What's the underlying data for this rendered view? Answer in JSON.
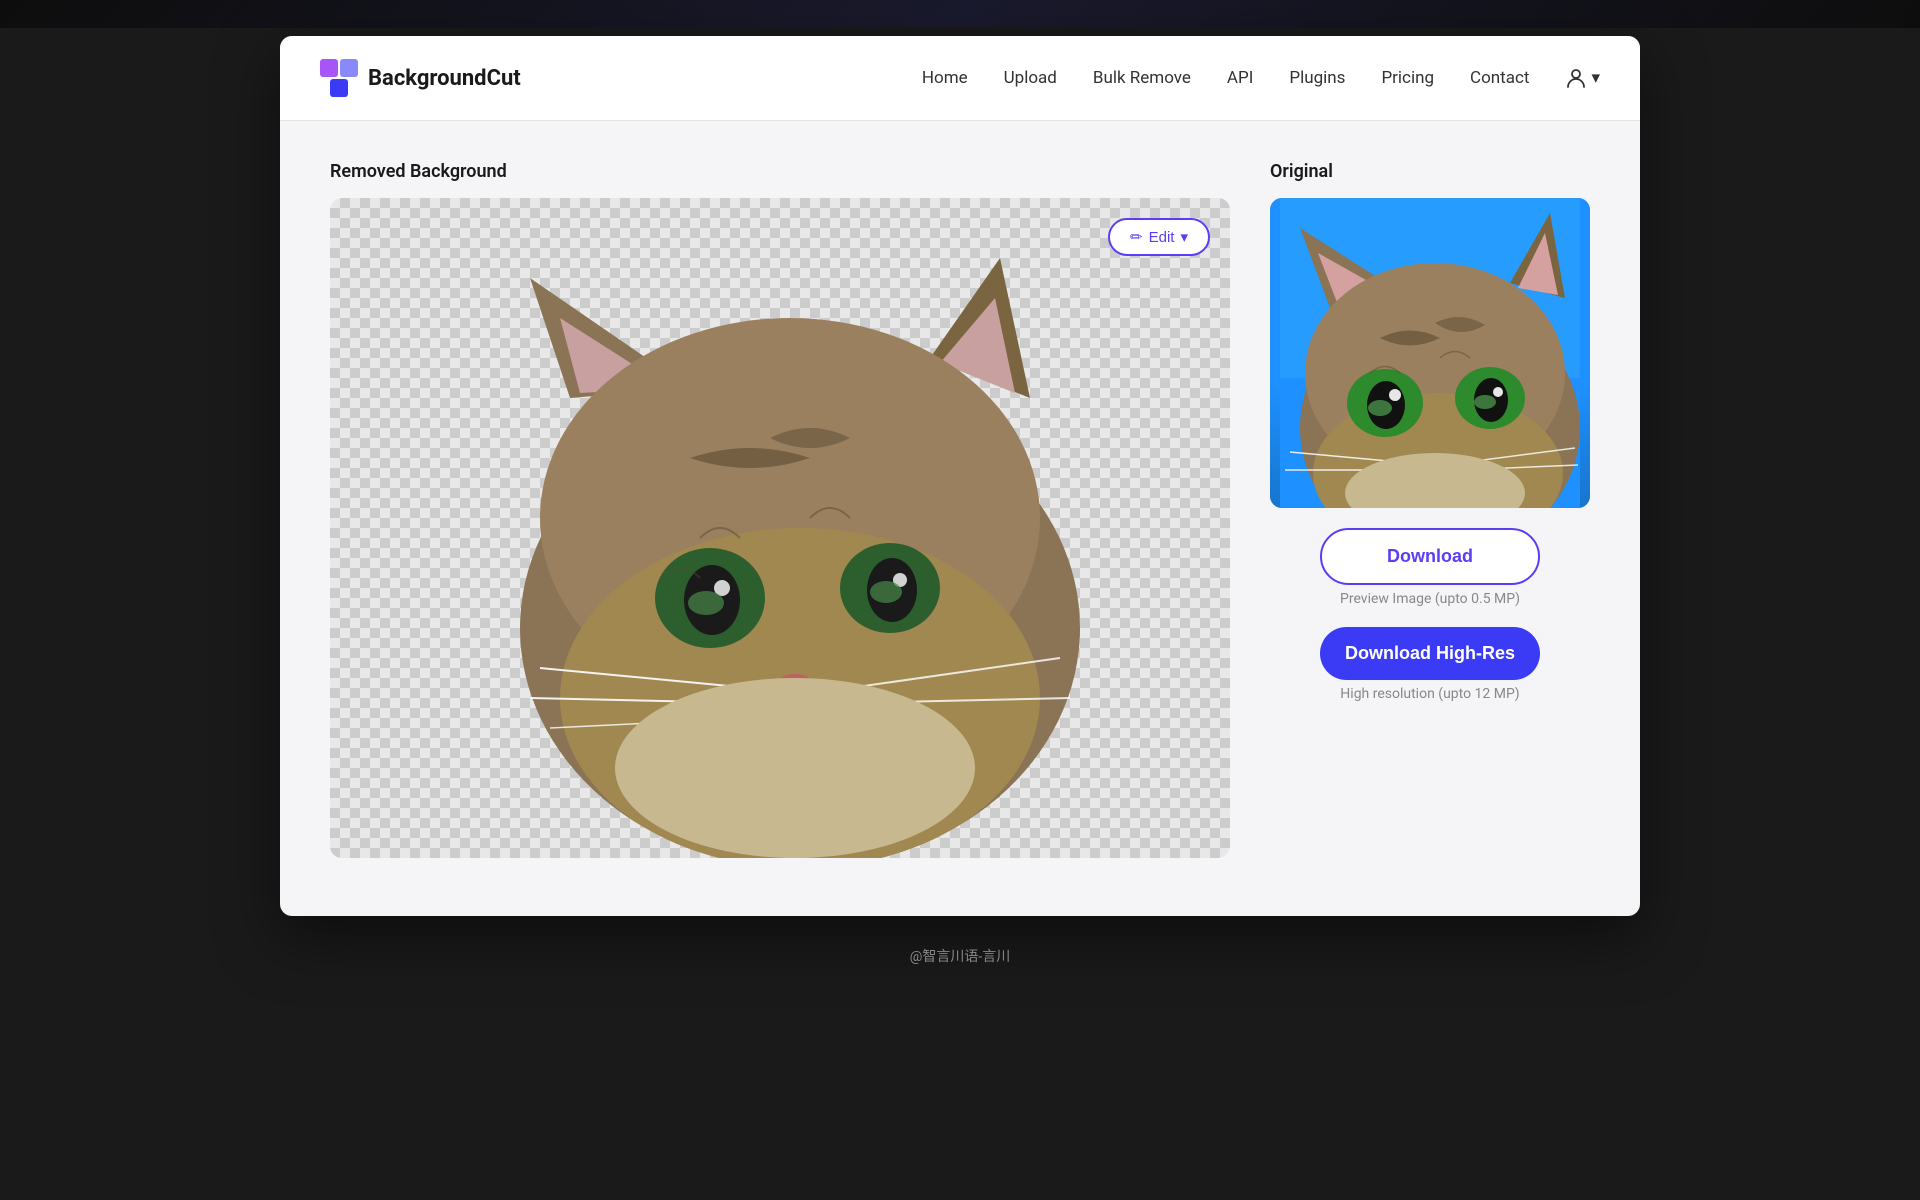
{
  "app": {
    "title": "BackgroundCut",
    "logo_alt": "BackgroundCut Logo"
  },
  "navbar": {
    "logo_text": "BackgroundCut",
    "links": [
      {
        "id": "home",
        "label": "Home"
      },
      {
        "id": "upload",
        "label": "Upload"
      },
      {
        "id": "bulk-remove",
        "label": "Bulk Remove"
      },
      {
        "id": "api",
        "label": "API"
      },
      {
        "id": "plugins",
        "label": "Plugins"
      },
      {
        "id": "pricing",
        "label": "Pricing"
      },
      {
        "id": "contact",
        "label": "Contact"
      }
    ],
    "user_dropdown_arrow": "▾"
  },
  "left_panel": {
    "title": "Removed Background",
    "edit_button_label": "✏ Edit",
    "edit_button_arrow": "▾"
  },
  "right_panel": {
    "title": "Original",
    "download_label": "Download",
    "preview_label": "Preview Image (upto 0.5 MP)",
    "download_highres_label": "Download High-Res",
    "highres_label": "High resolution (upto 12 MP)"
  },
  "footer": {
    "text": "@智言川语-言川"
  },
  "colors": {
    "accent": "#5b3df5",
    "accent_dark": "#3b3bf5",
    "blue_bg": "#1e90ff"
  }
}
